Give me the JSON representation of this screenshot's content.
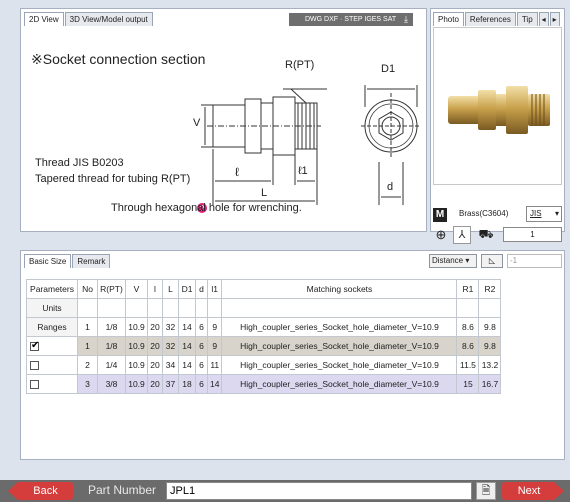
{
  "drawing_tabs": [
    "2D View",
    "3D View/Model output"
  ],
  "download_button": "DWG DXF · STEP IGES SAT",
  "drawing": {
    "heading": "※Socket connection section",
    "rpt_label": "R(PT)",
    "d1_label": "D1",
    "v_label": "V",
    "l_small": "ℓ",
    "l1_label": "ℓ1",
    "L_label": "L",
    "d_label": "d",
    "thread_line1": "Thread JIS B0203",
    "thread_line2": "Tapered thread for tubing R(PT)",
    "note": "Through hexagonal hole for wrenching."
  },
  "photo_tabs": [
    "Photo",
    "References",
    "Tip"
  ],
  "material": {
    "m_badge": "M",
    "name": "Brass(C3604)",
    "standard": "JIS",
    "quantity": "1"
  },
  "table_tabs": [
    "Basic Size",
    "Remark"
  ],
  "distance": {
    "label": "Distance",
    "value": "-1"
  },
  "table": {
    "headers": [
      "Parameters",
      "No",
      "R(PT)",
      "V",
      "l",
      "L",
      "D1",
      "d",
      "l1",
      "Matching sockets",
      "R1",
      "R2"
    ],
    "units_label": "Units",
    "ranges_label": "Ranges",
    "ranges": [
      "1",
      "1/8",
      "10.9",
      "20",
      "32",
      "14",
      "6",
      "9",
      "High_coupler_series_Socket_hole_diameter_V=10.9",
      "8.6",
      "9.8"
    ],
    "rows": [
      {
        "checked": true,
        "cells": [
          "1",
          "1/8",
          "10.9",
          "20",
          "32",
          "14",
          "6",
          "9",
          "High_coupler_series_Socket_hole_diameter_V=10.9",
          "8.6",
          "9.8"
        ]
      },
      {
        "checked": false,
        "cells": [
          "2",
          "1/4",
          "10.9",
          "20",
          "34",
          "14",
          "6",
          "11",
          "High_coupler_series_Socket_hole_diameter_V=10.9",
          "11.5",
          "13.2"
        ]
      },
      {
        "checked": false,
        "cells": [
          "3",
          "3/8",
          "10.9",
          "20",
          "37",
          "18",
          "6",
          "14",
          "High_coupler_series_Socket_hole_diameter_V=10.9",
          "15",
          "16.7"
        ]
      }
    ]
  },
  "bottom": {
    "back": "Back",
    "part_number_label": "Part Number",
    "part_number": "JPL1",
    "next": "Next"
  },
  "colors": {
    "nav_red": "#d53c3c",
    "selected_row": "#d8d4cc",
    "highlight_row": "#dcd8f0",
    "note_icon": "#e0207a"
  }
}
